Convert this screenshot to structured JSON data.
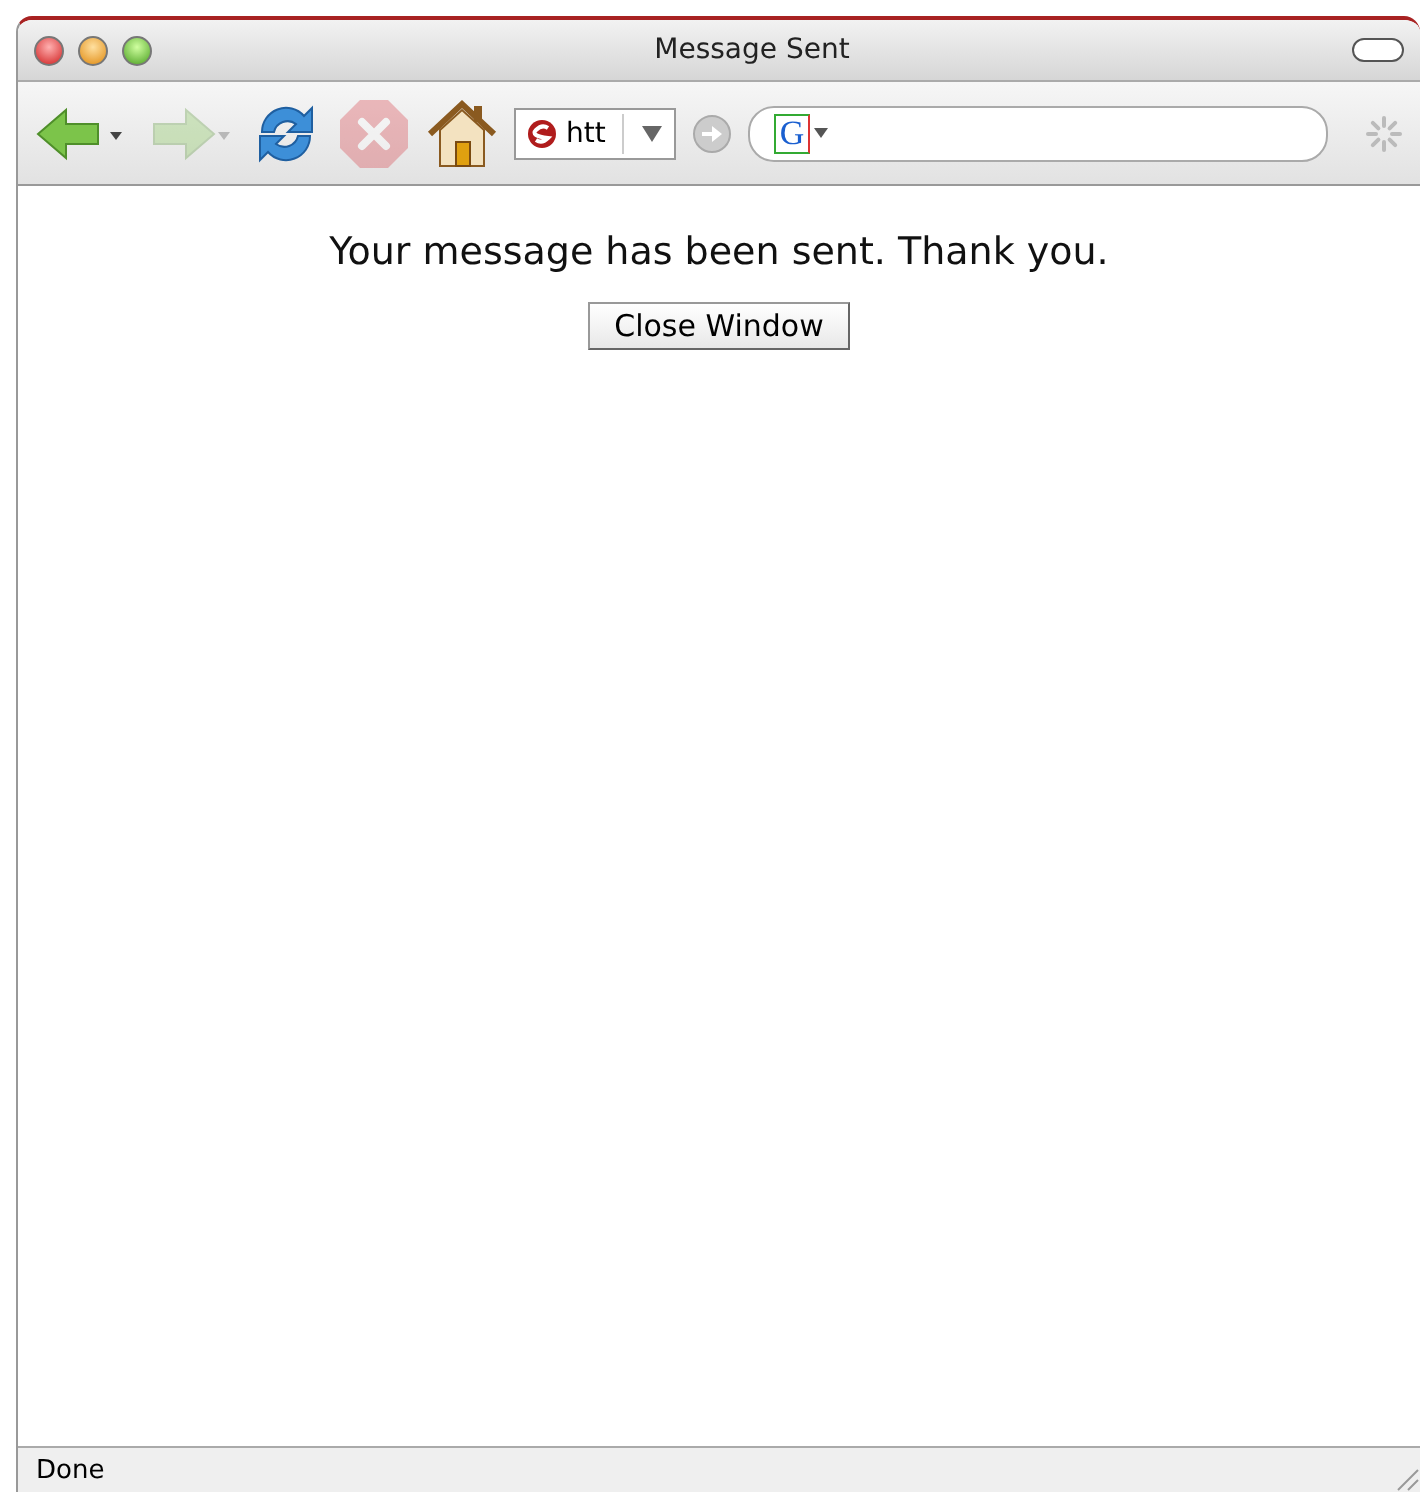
{
  "window": {
    "title": "Message Sent"
  },
  "toolbar": {
    "buttons": [
      {
        "kind": "back",
        "disabled": false
      },
      {
        "kind": "forward",
        "disabled": true
      },
      {
        "kind": "reload",
        "disabled": false
      },
      {
        "kind": "stop",
        "disabled": true
      },
      {
        "kind": "home",
        "disabled": false
      }
    ],
    "url": {
      "value": "htt"
    },
    "search": {
      "engine": "G"
    }
  },
  "page": {
    "message": "Your message has been sent. Thank you.",
    "button": "Close Window"
  },
  "status_bar": {
    "text": "Done"
  }
}
